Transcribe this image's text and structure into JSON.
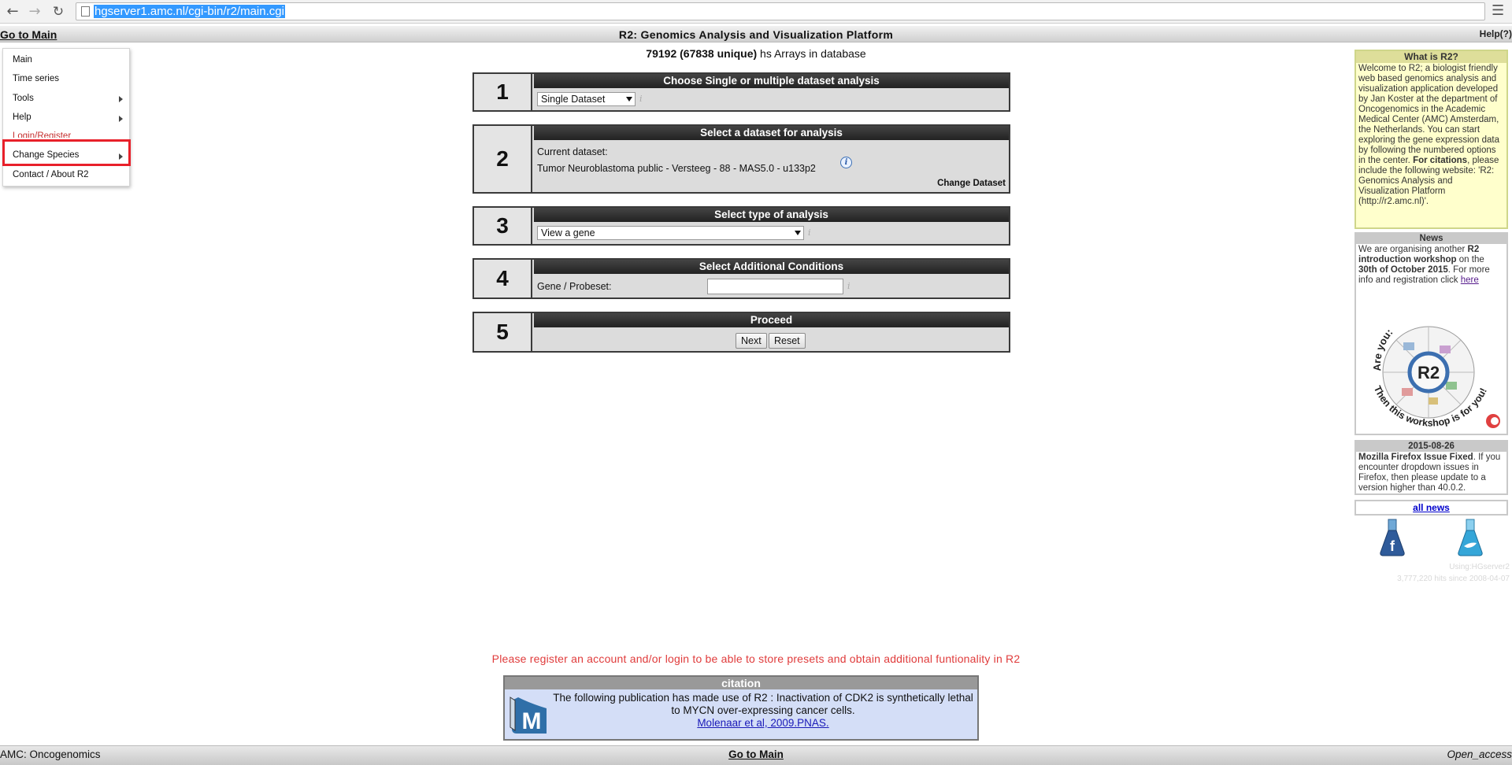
{
  "browser": {
    "url": "hgserver1.amc.nl/cgi-bin/r2/main.cgi"
  },
  "header": {
    "goto_main": "Go to Main",
    "title": "R2: Genomics Analysis and Visualization Platform",
    "help": "Help(?)"
  },
  "menu": {
    "items": [
      "Main",
      "Time series",
      "Tools",
      "Help",
      "Login/Register",
      "Change Species",
      "Contact / About R2"
    ]
  },
  "arrays": {
    "count": "79192 (67838 unique)",
    "suffix": "hs Arrays in database"
  },
  "steps": [
    {
      "num": "1",
      "title": "Choose Single or multiple dataset analysis",
      "select": "Single Dataset"
    },
    {
      "num": "2",
      "title": "Select a dataset for analysis",
      "current_label": "Current dataset:",
      "dataset": "Tumor Neuroblastoma public - Versteeg - 88 - MAS5.0 - u133p2",
      "change": "Change Dataset"
    },
    {
      "num": "3",
      "title": "Select type of analysis",
      "select": "View a gene"
    },
    {
      "num": "4",
      "title": "Select Additional Conditions",
      "label": "Gene / Probeset:",
      "value": ""
    },
    {
      "num": "5",
      "title": "Proceed",
      "next": "Next",
      "reset": "Reset"
    }
  ],
  "info_glyph": "i",
  "sidebar": {
    "what_title": "What is R2?",
    "what_text": "Welcome to R2; a biologist friendly web based genomics analysis and visualization application developed by Jan Koster at the department of Oncogenomics in the Academic Medical Center (AMC) Amsterdam, the Netherlands. You can start exploring the gene expression data by following the numbered options in the center.",
    "what_cite_bold": "For citations",
    "what_cite_rest": ", please include the following website: 'R2: Genomics Analysis and Visualization Platform (http://r2.amc.nl)'.",
    "news_title": "News",
    "news_pre": "We are organising another ",
    "news_bold1": "R2 introduction workshop",
    "news_mid": " on the ",
    "news_bold2": "30th of October 2015",
    "news_post": ". For more info and registration click ",
    "news_link": "here",
    "workshop_top": "Are you:",
    "workshop_bottom": "Then this workshop is for you!",
    "workshop_center": "R2",
    "date_title": "2015-08-26",
    "date_bold": "Mozilla Firefox Issue Fixed",
    "date_text": ". If you encounter dropdown issues in Firefox, then please update to a version higher than 40.0.2.",
    "all_news": "all news",
    "using": "Using:HGserver2",
    "hits": "3,777,220 hits since 2008-04-07"
  },
  "register_msg": "Please register an account and/or login to be able to store presets and obtain additional funtionality in R2",
  "citation": {
    "title": "citation",
    "text": "The following publication has made use of R2 : Inactivation of CDK2 is synthetically lethal to MYCN over-expressing cancer cells.",
    "link": "Molenaar et al, 2009.PNAS."
  },
  "footer": {
    "left": "AMC: Oncogenomics",
    "center": "Go to Main",
    "right": "Open_access"
  },
  "colors": {
    "highlight": "#e8202a",
    "step_header": "#2a2a2a",
    "what_bg": "#ffffcc",
    "citation_bg": "#d4def7",
    "register": "#e03b3b"
  }
}
